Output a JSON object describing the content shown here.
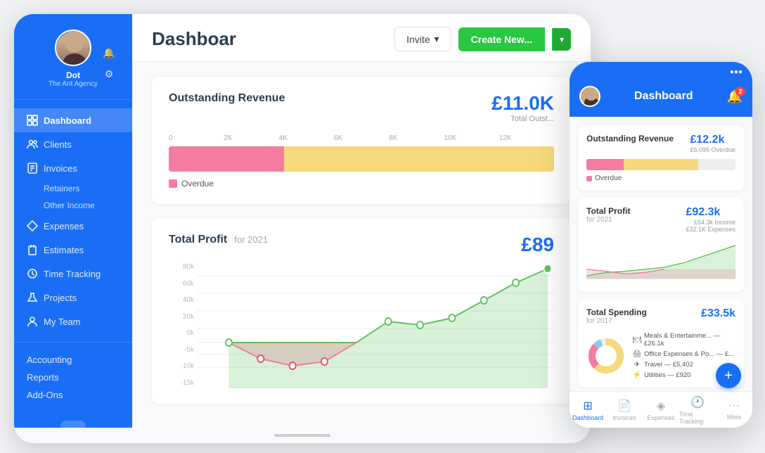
{
  "tablet": {
    "sidebar": {
      "user_name": "Dot",
      "user_agency": "The Ant Agency",
      "nav_items": [
        {
          "label": "Dashboard",
          "icon": "grid",
          "active": true
        },
        {
          "label": "Clients",
          "icon": "users",
          "active": false
        },
        {
          "label": "Invoices",
          "icon": "file-text",
          "active": false
        },
        {
          "label": "Retainers",
          "icon": "",
          "active": false,
          "sub": true
        },
        {
          "label": "Other Income",
          "icon": "",
          "active": false,
          "sub": true
        },
        {
          "label": "Expenses",
          "icon": "diamond",
          "active": false
        },
        {
          "label": "Estimates",
          "icon": "clipboard",
          "active": false
        },
        {
          "label": "Time Tracking",
          "icon": "clock",
          "active": false
        },
        {
          "label": "Projects",
          "icon": "flask",
          "active": false
        },
        {
          "label": "My Team",
          "icon": "person",
          "active": false
        }
      ],
      "bottom_items": [
        {
          "label": "Accounting"
        },
        {
          "label": "Reports"
        },
        {
          "label": "Add-Ons"
        }
      ]
    },
    "header": {
      "title": "Dashboar",
      "invite_label": "Invite",
      "create_label": "Create New..."
    },
    "revenue_card": {
      "title": "Outstanding Revenue",
      "amount": "£11.0K",
      "amount_label": "Total Outst...",
      "axis_labels": [
        "0",
        "2K",
        "4K",
        "6K",
        "8K",
        "10K",
        "12K"
      ],
      "legend_label": "Overdue"
    },
    "profit_card": {
      "title": "Total Profit",
      "subtitle": "for 2021",
      "amount": "£89",
      "amount_suffix": "...",
      "y_labels": [
        "80k",
        "60k",
        "40k",
        "20k",
        "0k",
        "-5k",
        "-10k",
        "-15k"
      ]
    }
  },
  "phone": {
    "header": {
      "title": "Dashboard",
      "notif_count": "2"
    },
    "revenue_card": {
      "title": "Outstanding Revenue",
      "amount": "£12.2k",
      "overdue_label": "£6,095 Overdue",
      "legend": "Overdue"
    },
    "profit_card": {
      "title": "Total Profit",
      "subtitle": "for 2021",
      "amount": "£92.3k",
      "income": "£54.3k Income",
      "expenses": "£32.1K Expenses"
    },
    "spending_card": {
      "title": "Total Spending",
      "subtitle": "for 2017",
      "amount": "£33.5k",
      "items": [
        {
          "icon": "🍽",
          "label": "Meals & Entertainme... — £26.1k"
        },
        {
          "icon": "🖨",
          "label": "Office Expenses & Po... — £..."
        },
        {
          "icon": "✈",
          "label": "Travel — £5,402"
        },
        {
          "icon": "⚡",
          "label": "Utilities — £920"
        }
      ]
    },
    "bottom_nav": [
      {
        "label": "Dashboard",
        "icon": "grid",
        "active": true
      },
      {
        "label": "Invoices",
        "icon": "file",
        "active": false
      },
      {
        "label": "Expenses",
        "icon": "diamond",
        "active": false
      },
      {
        "label": "Time Tracking",
        "icon": "clock",
        "active": false
      },
      {
        "label": "More",
        "icon": "dots",
        "active": false
      }
    ]
  }
}
